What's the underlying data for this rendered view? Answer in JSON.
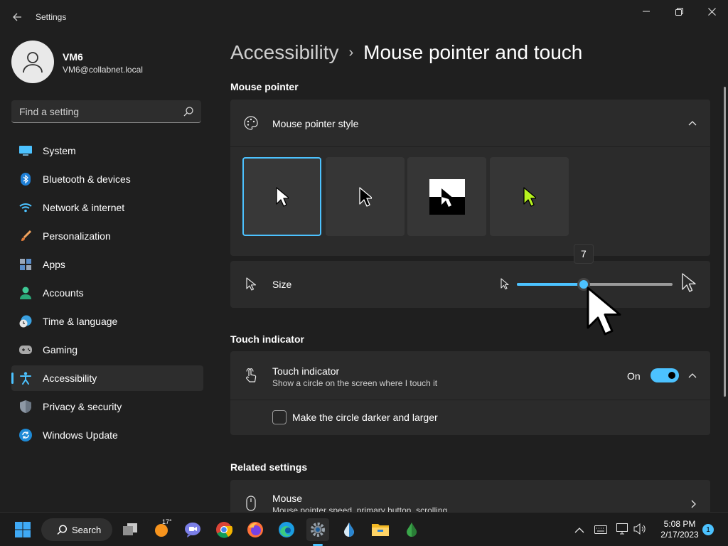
{
  "window": {
    "title": "Settings",
    "back_icon": "back-arrow-icon",
    "minimize_icon": "minimize-icon",
    "maximize_icon": "restore-icon",
    "close_icon": "close-icon"
  },
  "profile": {
    "name": "VM6",
    "email": "VM6@collabnet.local"
  },
  "search": {
    "placeholder": "Find a setting"
  },
  "sidebar": {
    "items": [
      {
        "label": "System",
        "icon": "system-icon",
        "active": false
      },
      {
        "label": "Bluetooth & devices",
        "icon": "bluetooth-icon",
        "active": false
      },
      {
        "label": "Network & internet",
        "icon": "wifi-icon",
        "active": false
      },
      {
        "label": "Personalization",
        "icon": "brush-icon",
        "active": false
      },
      {
        "label": "Apps",
        "icon": "apps-icon",
        "active": false
      },
      {
        "label": "Accounts",
        "icon": "accounts-icon",
        "active": false
      },
      {
        "label": "Time & language",
        "icon": "clock-globe-icon",
        "active": false
      },
      {
        "label": "Gaming",
        "icon": "gamepad-icon",
        "active": false
      },
      {
        "label": "Accessibility",
        "icon": "accessibility-icon",
        "active": true
      },
      {
        "label": "Privacy & security",
        "icon": "shield-icon",
        "active": false
      },
      {
        "label": "Windows Update",
        "icon": "update-icon",
        "active": false
      }
    ]
  },
  "main": {
    "breadcrumb_parent": "Accessibility",
    "breadcrumb_separator": "›",
    "breadcrumb_current": "Mouse pointer and touch",
    "mouse_pointer_section": "Mouse pointer",
    "pointer_style_label": "Mouse pointer style",
    "pointer_styles": [
      {
        "name": "white",
        "selected": true
      },
      {
        "name": "black",
        "selected": false
      },
      {
        "name": "inverted",
        "selected": false
      },
      {
        "name": "custom",
        "selected": false,
        "color": "#b6f21f"
      }
    ],
    "size_label": "Size",
    "size_value": "7",
    "size_min": 1,
    "size_max": 15,
    "touch_section": "Touch indicator",
    "touch_label": "Touch indicator",
    "touch_description": "Show a circle on the screen where I touch it",
    "touch_state": "On",
    "darker_label": "Make the circle darker and larger",
    "darker_checked": false,
    "related_section": "Related settings",
    "mouse_label": "Mouse",
    "mouse_description": "Mouse pointer speed, primary button, scrolling"
  },
  "taskbar": {
    "search_label": "Search",
    "weather_temp": "17°",
    "time": "5:08 PM",
    "date": "2/17/2023",
    "notifications": "1",
    "apps": [
      "start-icon",
      "search-icon",
      "task-view-icon",
      "weather-icon",
      "chat-icon",
      "chrome-icon",
      "firefox-icon",
      "edge-icon",
      "settings-icon",
      "water-drop-icon",
      "file-explorer-icon",
      "green-drop-icon"
    ]
  },
  "colors": {
    "accent": "#4cc2ff",
    "background": "#1f1f1f",
    "card": "#2b2b2b"
  }
}
